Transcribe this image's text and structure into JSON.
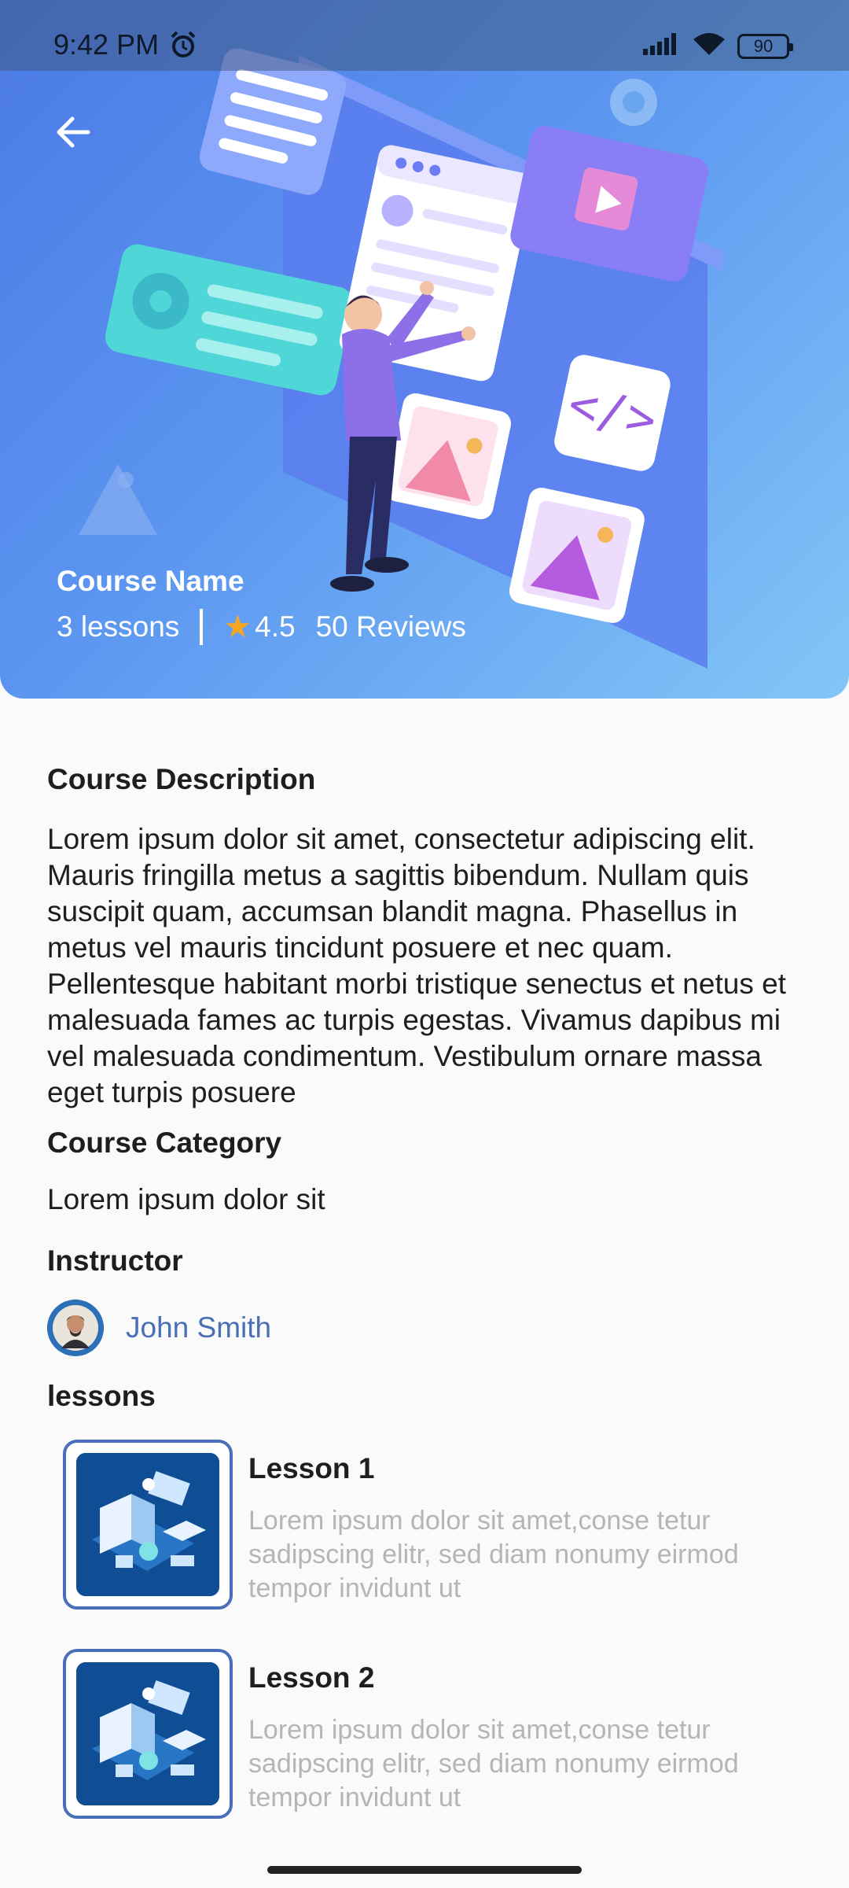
{
  "status_bar": {
    "time": "9:42 PM",
    "alarm_icon": "alarm-clock-icon",
    "signal_icon": "cell-signal-icon",
    "wifi_icon": "wifi-icon",
    "battery": "90"
  },
  "hero": {
    "back_icon": "arrow-left-icon",
    "course_name": "Course Name",
    "lessons_count": "3 lessons",
    "rating_icon": "star-icon",
    "rating": "4.5",
    "reviews": "50 Reviews",
    "gradient_colors": [
      "#4b79e6",
      "#82c6f7"
    ]
  },
  "description": {
    "title": "Course Description",
    "text": "Lorem ipsum dolor sit amet, consectetur adipiscing elit. Mauris fringilla metus a sagittis bibendum. Nullam quis suscipit quam, accumsan blandit magna. Phasellus in metus vel mauris tincidunt posuere et nec quam. Pellentesque habitant morbi tristique senectus et netus et malesuada fames ac turpis egestas. Vivamus dapibus mi vel malesuada condimentum. Vestibulum ornare massa eget turpis posuere"
  },
  "category": {
    "title": "Course Category",
    "text": "Lorem ipsum dolor sit"
  },
  "instructor": {
    "title": "Instructor",
    "name": "John Smith"
  },
  "lessons": {
    "title": "lessons",
    "items": [
      {
        "title": "Lesson 1",
        "description": "Lorem ipsum dolor sit amet,conse tetur\nsadipscing elitr, sed diam nonumy eirmod\n tempor invidunt ut"
      },
      {
        "title": "Lesson 2",
        "description": "Lorem ipsum dolor sit amet,conse tetur\nsadipscing elitr, sed diam nonumy eirmod\n tempor invidunt ut"
      }
    ]
  },
  "colors": {
    "accent": "#4a6fb5",
    "star": "#f5a623",
    "muted_text": "#b5b5b5"
  }
}
